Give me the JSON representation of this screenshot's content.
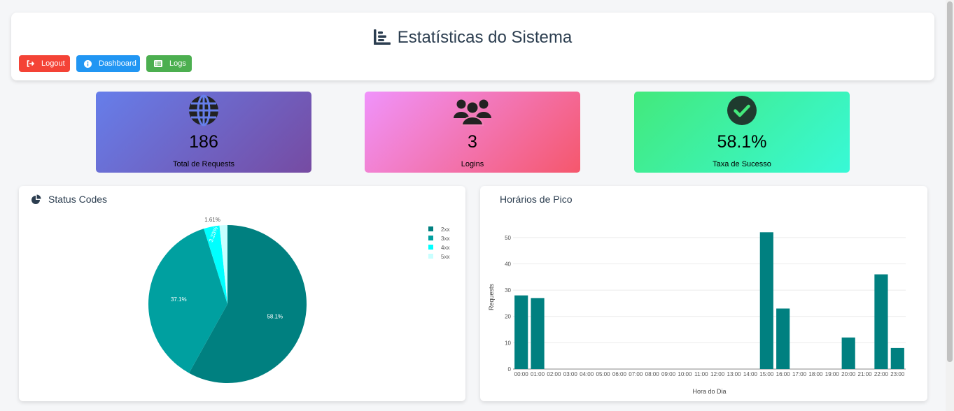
{
  "header": {
    "title": "Estatísticas do Sistema",
    "title_icon": "chart-bar-icon",
    "buttons": {
      "logout": "Logout",
      "dashboard": "Dashboard",
      "logs": "Logs"
    }
  },
  "stats": [
    {
      "icon": "globe-icon",
      "value": "186",
      "label": "Total de Requests"
    },
    {
      "icon": "users-icon",
      "value": "3",
      "label": "Logins"
    },
    {
      "icon": "check-circle-icon",
      "value": "58.1%",
      "label": "Taxa de Sucesso"
    }
  ],
  "panels": {
    "status_codes": {
      "title": "Status Codes",
      "icon": "pie-chart-icon"
    },
    "peak_hours": {
      "title": "Horários de Pico"
    }
  },
  "colors": {
    "logout": "#f44336",
    "dashboard": "#2196f3",
    "logs": "#4caf50",
    "bars": "#008080"
  },
  "chart_data": [
    {
      "type": "pie",
      "labels": [
        "2xx",
        "3xx",
        "4xx",
        "5xx"
      ],
      "values": [
        58.1,
        37.1,
        3.23,
        1.61
      ],
      "data_labels": [
        "58.1%",
        "37.1%",
        "3.23%",
        "1.61%"
      ],
      "colors": [
        "#008080",
        "#00a0a0",
        "#00ffff",
        "#c8ffff"
      ],
      "legend": "top-right"
    },
    {
      "type": "bar",
      "categories": [
        "00:00",
        "01:00",
        "02:00",
        "03:00",
        "04:00",
        "05:00",
        "06:00",
        "07:00",
        "08:00",
        "09:00",
        "10:00",
        "11:00",
        "12:00",
        "13:00",
        "14:00",
        "15:00",
        "16:00",
        "17:00",
        "18:00",
        "19:00",
        "20:00",
        "21:00",
        "22:00",
        "23:00"
      ],
      "values": [
        28,
        27,
        0,
        0,
        0,
        0,
        0,
        0,
        0,
        0,
        0,
        0,
        0,
        0,
        0,
        52,
        23,
        0,
        0,
        0,
        12,
        0,
        36,
        8
      ],
      "xlabel": "Hora do Dia",
      "ylabel": "Requests",
      "yticks": [
        0,
        10,
        20,
        30,
        40,
        50
      ],
      "ylim": [
        0,
        55
      ],
      "grid": true,
      "color": "#008080"
    }
  ]
}
